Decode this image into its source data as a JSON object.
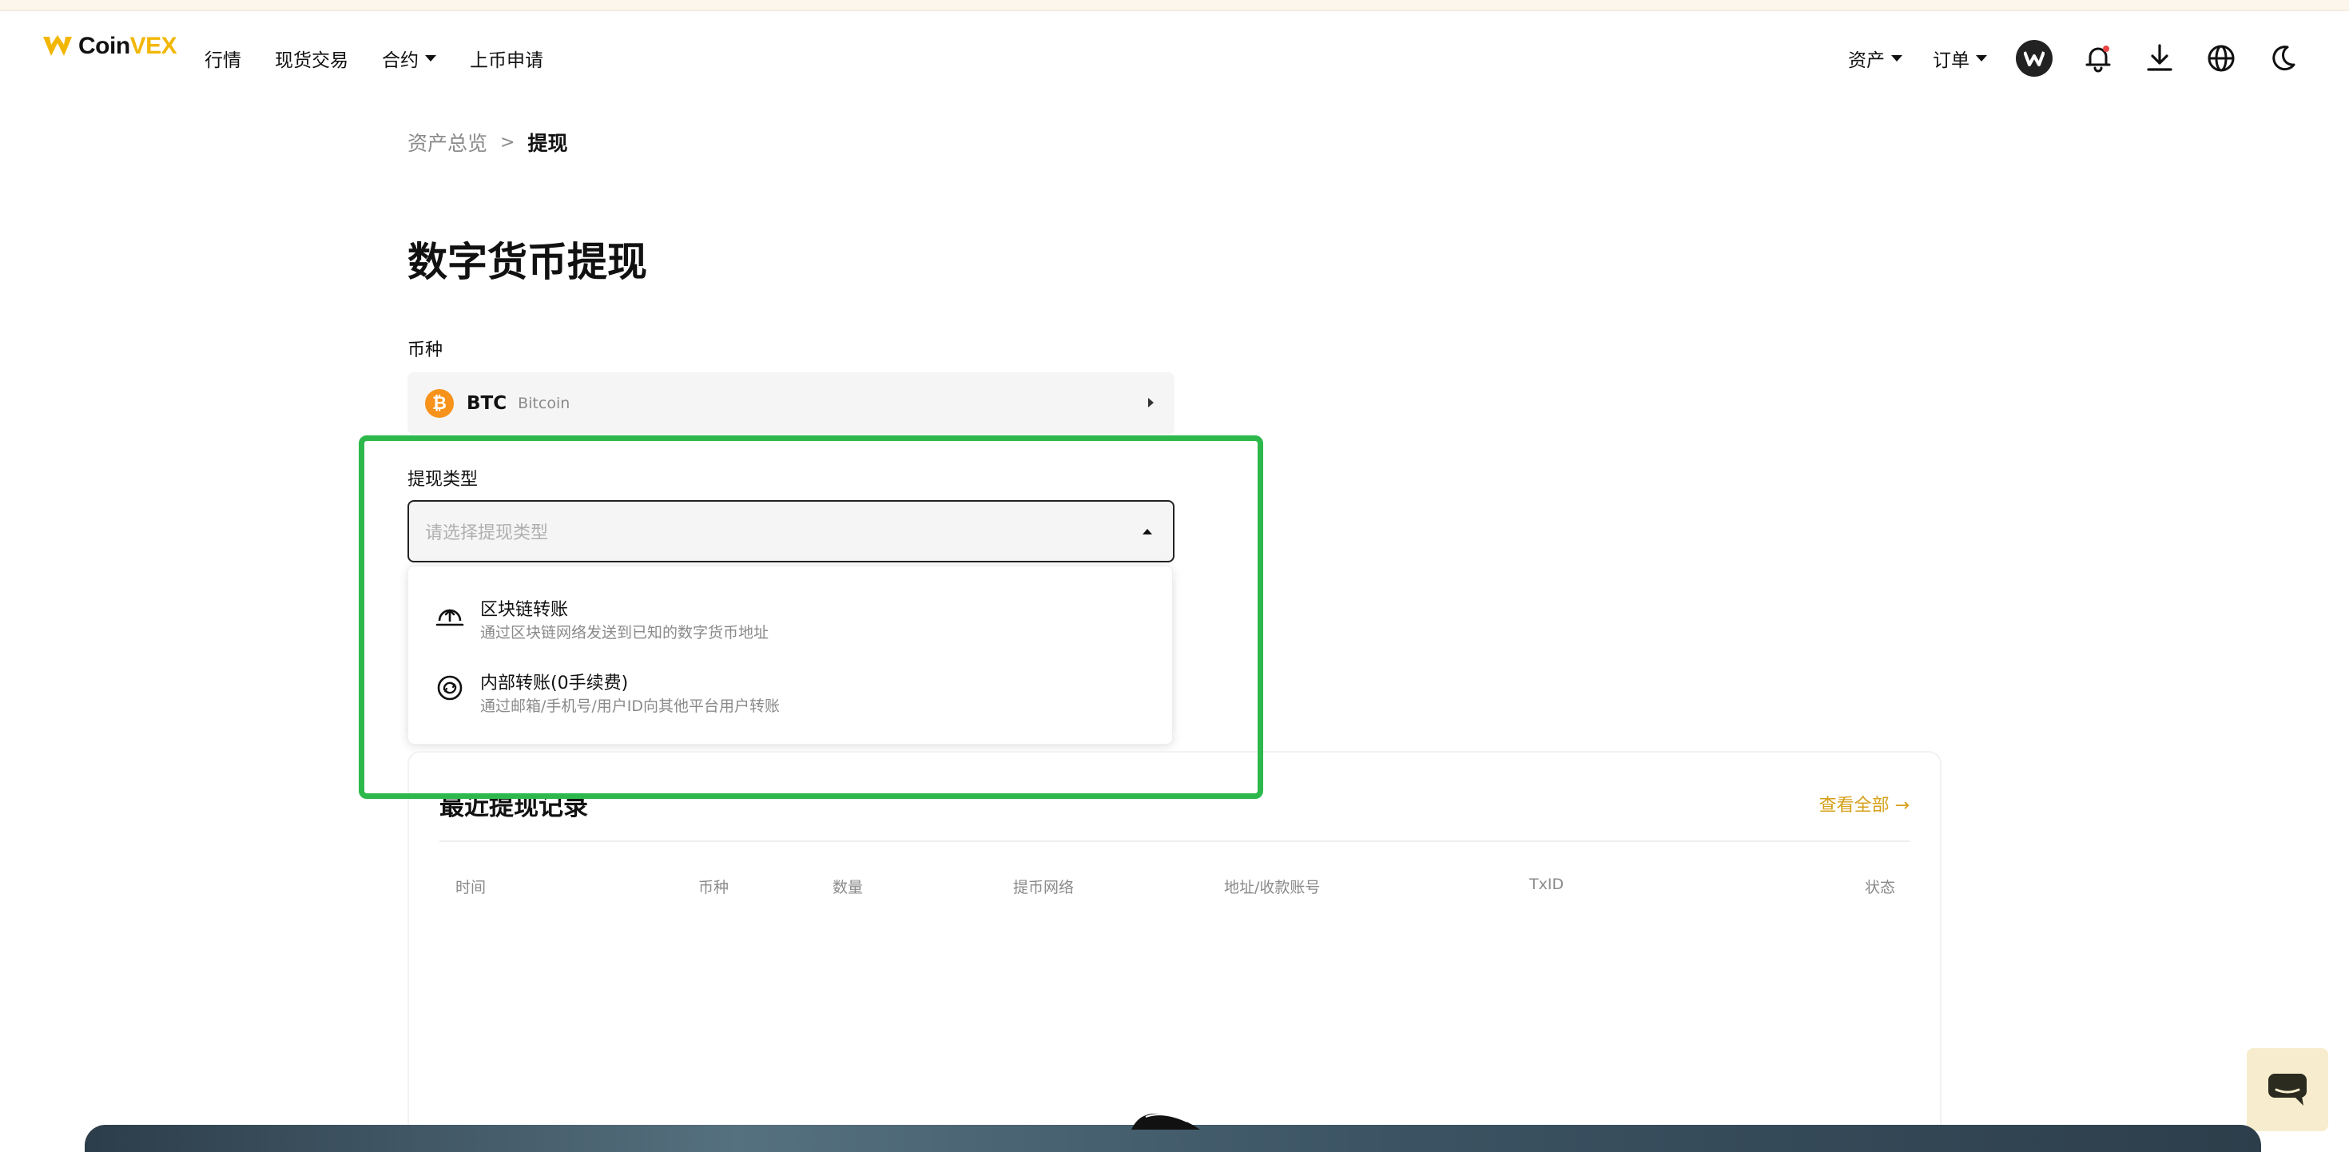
{
  "app": {
    "logo_coin": "Coin",
    "logo_vex": "VEX",
    "brand_color": "#f2b705"
  },
  "nav": {
    "items": [
      "行情",
      "现货交易",
      "合约",
      "上币申请"
    ]
  },
  "header_right": {
    "assets": "资产",
    "orders": "订单",
    "icons": [
      "user-avatar-icon",
      "bell-icon",
      "download-icon",
      "globe-icon",
      "moon-icon"
    ]
  },
  "breadcrumb": {
    "parent": "资产总览",
    "separator": ">",
    "current": "提现"
  },
  "page": {
    "title": "数字货币提现"
  },
  "coin_field": {
    "label": "币种",
    "symbol": "BTC",
    "name": "Bitcoin",
    "icon_glyph": "₿"
  },
  "type_field": {
    "label": "提现类型",
    "placeholder": "请选择提现类型",
    "options": [
      {
        "title": "区块链转账",
        "desc": "通过区块链网络发送到已知的数字货币地址",
        "icon": "upload-cloud-icon"
      },
      {
        "title": "内部转账(0手续费)",
        "desc": "通过邮箱/手机号/用户ID向其他平台用户转账",
        "icon": "transfer-circle-icon"
      }
    ]
  },
  "records": {
    "title": "最近提现记录",
    "view_all": "查看全部 →",
    "columns": [
      "时间",
      "币种",
      "数量",
      "提币网络",
      "地址/收款账号",
      "TxID",
      "状态"
    ]
  },
  "colors": {
    "highlight": "#2db84c",
    "link": "#d6a019"
  }
}
